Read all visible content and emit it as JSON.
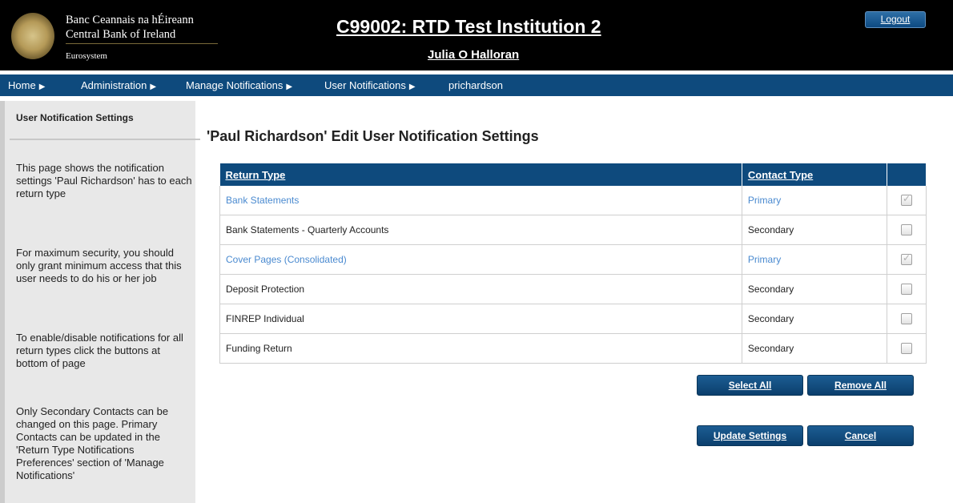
{
  "header": {
    "bank_name_irish": "Banc Ceannais na hÉireann",
    "bank_name_english": "Central Bank of Ireland",
    "eurosystem": "Eurosystem",
    "institution_title": "C99002: RTD Test Institution 2",
    "user_name": "Julia O Halloran",
    "logout_label": "Logout"
  },
  "breadcrumb": [
    {
      "label": "Home",
      "arrow": "▶"
    },
    {
      "label": "Administration",
      "arrow": "▶"
    },
    {
      "label": "Manage Notifications",
      "arrow": "▶"
    },
    {
      "label": "User Notifications",
      "arrow": "▶"
    },
    {
      "label": "prichardson",
      "arrow": ""
    }
  ],
  "sidebar": {
    "title": "User Notification Settings",
    "paragraphs": [
      "This page shows the notification settings 'Paul Richardson' has to each return type",
      "For maximum security, you should only grant minimum access that this user needs to do his or her job",
      "To enable/disable notifications for all return types click the buttons at bottom of page",
      "Only Secondary Contacts can be changed on this page. Primary Contacts can be updated in the 'Return Type Notifications Preferences' section of 'Manage Notifications'"
    ]
  },
  "main": {
    "title": "'Paul Richardson' Edit User Notification Settings",
    "table": {
      "headers": [
        "Return Type",
        "Contact Type",
        ""
      ],
      "rows": [
        {
          "return_type": "Bank Statements",
          "contact_type": "Primary",
          "checked": true
        },
        {
          "return_type": "Bank Statements - Quarterly Accounts",
          "contact_type": "Secondary",
          "checked": false
        },
        {
          "return_type": "Cover Pages (Consolidated)",
          "contact_type": "Primary",
          "checked": true
        },
        {
          "return_type": "Deposit Protection",
          "contact_type": "Secondary",
          "checked": false
        },
        {
          "return_type": "FINREP Individual",
          "contact_type": "Secondary",
          "checked": false
        },
        {
          "return_type": "Funding Return",
          "contact_type": "Secondary",
          "checked": false
        }
      ]
    },
    "buttons": {
      "select_all": "Select All",
      "remove_all": "Remove All",
      "update_settings": "Update Settings",
      "cancel": "Cancel"
    }
  },
  "colors": {
    "nav_blue": "#0e4a7d",
    "primary_link": "#4a8ad0",
    "header_bg": "#000000"
  }
}
